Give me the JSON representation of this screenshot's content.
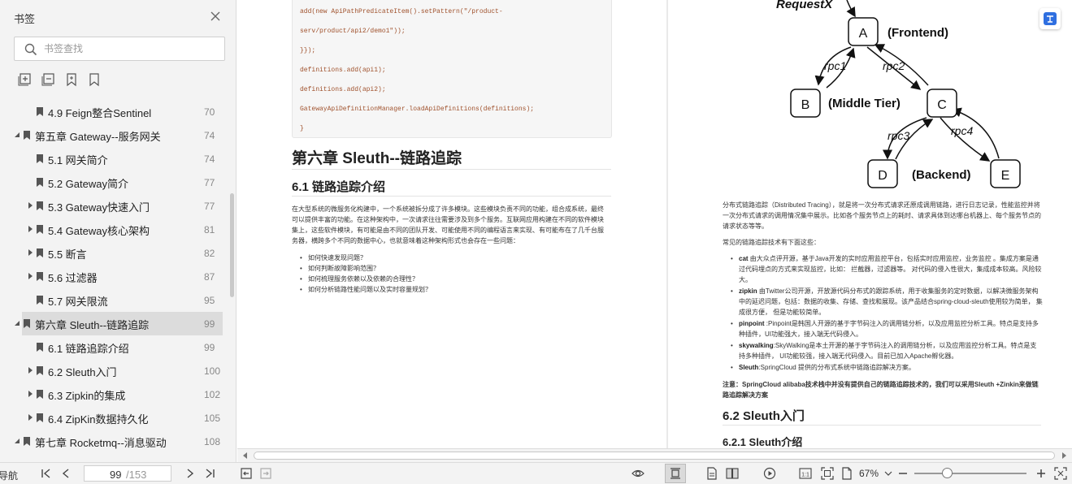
{
  "sidebar": {
    "title": "书签",
    "search_placeholder": "书签查找",
    "items": [
      {
        "label": "4.9 Feign整合Sentinel",
        "page": "70",
        "level": 2,
        "expandable": false
      },
      {
        "label": "第五章 Gateway--服务网关",
        "page": "74",
        "level": 1,
        "expandable": true
      },
      {
        "label": "5.1 网关简介",
        "page": "74",
        "level": 2,
        "expandable": false
      },
      {
        "label": "5.2 Gateway简介",
        "page": "77",
        "level": 2,
        "expandable": false
      },
      {
        "label": "5.3 Gateway快速入门",
        "page": "77",
        "level": 2,
        "expandable": true
      },
      {
        "label": "5.4 Gateway核心架构",
        "page": "81",
        "level": 2,
        "expandable": true
      },
      {
        "label": "5.5 断言",
        "page": "82",
        "level": 2,
        "expandable": true
      },
      {
        "label": "5.6 过滤器",
        "page": "87",
        "level": 2,
        "expandable": true
      },
      {
        "label": "5.7 网关限流",
        "page": "95",
        "level": 2,
        "expandable": false
      },
      {
        "label": "第六章 Sleuth--链路追踪",
        "page": "99",
        "level": 1,
        "expandable": true,
        "selected": true
      },
      {
        "label": "6.1 链路追踪介绍",
        "page": "99",
        "level": 2,
        "expandable": false
      },
      {
        "label": "6.2 Sleuth入门",
        "page": "100",
        "level": 2,
        "expandable": true
      },
      {
        "label": "6.3 Zipkin的集成",
        "page": "102",
        "level": 2,
        "expandable": true
      },
      {
        "label": "6.4 ZipKin数据持久化",
        "page": "105",
        "level": 2,
        "expandable": true
      },
      {
        "label": "第七章 Rocketmq--消息驱动",
        "page": "108",
        "level": 1,
        "expandable": true
      }
    ]
  },
  "left_page": {
    "code": [
      "add(new ApiPathPredicateItem().setPattern(\"/product-",
      "serv/product/api2/demo1\"));",
      "}});",
      "definitions.add(api1);",
      "definitions.add(api2);",
      "GatewayApiDefinitionManager.loadApiDefinitions(definitions);",
      "}"
    ],
    "chapter_title": "第六章 Sleuth--链路追踪",
    "section_title": "6.1 链路追踪介绍",
    "intro": "在大型系统的微服务化构建中，一个系统被拆分成了许多模块。这些模块负责不同的功能，组合成系统，最终可以提供丰富的功能。在这种架构中，一次请求往往需要涉及到多个服务。互联网应用构建在不同的软件模块集上，这些软件模块，有可能是由不同的团队开发、可能使用不同的编程语言来实现、有可能布在了几千台服务器，横跨多个不同的数据中心，也就意味着这种架构形式也会存在一些问题：",
    "questions": [
      "如何快速发现问题？",
      "如何判断故障影响范围？",
      "如何梳理服务依赖以及依赖的合理性？",
      "如何分析链路性能问题以及实时容量规划？"
    ]
  },
  "right_page": {
    "diagram": {
      "request_label": "RequestX",
      "nodes": [
        "A",
        "B",
        "C",
        "D",
        "E"
      ],
      "tier_labels": [
        "(Frontend)",
        "(Middle Tier)",
        "(Backend)"
      ],
      "edge_labels": [
        "rpc1",
        "rpc2",
        "rpc3",
        "rpc4"
      ]
    },
    "para1": "分布式链路追踪（Distributed Tracing），就是将一次分布式请求还原成调用链路，进行日志记录，性能监控并将一次分布式请求的调用情况集中展示。比如各个服务节点上的耗时、请求具体到达哪台机器上、每个服务节点的请求状态等等。",
    "para2": "常见的链路追踪技术有下面这些：",
    "techs": [
      {
        "name": "cat",
        "desc": " 由大众点评开源，基于Java开发的实时应用监控平台，包括实时应用监控，业务监控 。集成方案是通过代码埋点的方式来实现监控，比如： 拦截器，过滤器等。 对代码的侵入性很大，集成成本较高。风险较大。"
      },
      {
        "name": "zipkin",
        "desc": " 由Twitter公司开源，开放源代码分布式的跟踪系统，用于收集服务的定时数据，以解决微服务架构中的延迟问题，包括：数据的收集、存储、查找和展现。该产品结合spring-cloud-sleuth使用较为简单， 集成很方便， 但是功能较简单。"
      },
      {
        "name": "pinpoint",
        "desc": " :Pinpoint是韩国人开源的基于字节码注入的调用链分析，以及应用监控分析工具。特点是支持多种插件，UI功能强大，接入端无代码侵入。"
      },
      {
        "name": "skywalking",
        "desc": ":SkyWalking是本土开源的基于字节码注入的调用链分析，以及应用监控分析工具。特点是支持多种插件， UI功能较强，接入端无代码侵入。目前已加入Apache孵化器。"
      },
      {
        "name": "Sleuth",
        "desc": ":SpringCloud 提供的分布式系统中链路追踪解决方案。"
      }
    ],
    "note": "注意：SpringCloud alibaba技术栈中并没有提供自己的链路追踪技术的，我们可以采用Sleuth +Zinkin来做链路追踪解决方案",
    "section_title": "6.2 Sleuth入门",
    "subsection_title": "6.2.1 Sleuth介绍"
  },
  "statusbar": {
    "nav_label": "导航",
    "current_page": "99",
    "total_pages": "/153",
    "zoom": "67%",
    "zoom_fraction": 0.29
  }
}
